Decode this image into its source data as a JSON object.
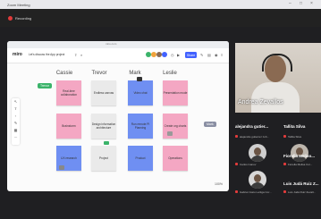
{
  "window": {
    "title": "Zoom Meeting",
    "recording_label": "Recording"
  },
  "browser": {
    "url": "miro.com"
  },
  "miro": {
    "logo": "miro",
    "board_name": "Let's discuss the App project",
    "share_label": "Share",
    "zoom_level": "100%",
    "columns": [
      "Cassie",
      "Trevor",
      "Mark",
      "Leslie"
    ],
    "stickies": [
      {
        "text": "Real-time collaboration",
        "color": "#f4a7c3"
      },
      {
        "text": "Endless canvas",
        "color": "#eaeaea"
      },
      {
        "text": "Video chat",
        "color": "#6f8ff2"
      },
      {
        "text": "Presentation mode",
        "color": "#f4a7c3"
      },
      {
        "text": "Brainstorm",
        "color": "#f4a7c3"
      },
      {
        "text": "Design information architecture",
        "color": "#eaeaea"
      },
      {
        "text": "Run remote PI Planning",
        "color": "#6f8ff2"
      },
      {
        "text": "Create org charts",
        "color": "#f4a7c3"
      },
      {
        "text": "UX research",
        "color": "#6f8ff2"
      },
      {
        "text": "Project",
        "color": "#eaeaea"
      },
      {
        "text": "Product",
        "color": "#6f8ff2"
      },
      {
        "text": "Operations",
        "color": "#f4a7c3"
      }
    ],
    "cursors": [
      {
        "name": "Trevor",
        "color": "#3bb36a"
      },
      {
        "name": "Mark",
        "color": "#8a8fa3"
      }
    ]
  },
  "participants": {
    "main": {
      "name": "Andrea Zevallos"
    },
    "tiles": [
      {
        "name": "alejandra gutier...",
        "sub": "alejandra gutierrez zuh..."
      },
      {
        "name": "Tallita Silva",
        "sub": "Tallita Silva"
      },
      {
        "name": "Fiorella Meliso...",
        "sub": "Carlos Ivanov"
      },
      {
        "name": "Luis Judá Ruiz Z...",
        "sub": "Fiorella Melisa Cur..."
      },
      {
        "name": "",
        "sub": "Gabriel Justo Lartiga Cor..."
      },
      {
        "name": "",
        "sub": "Luis Judá Ruiz Zevall..."
      }
    ]
  },
  "icons": [
    "close-icon",
    "minimize-icon",
    "maximize-icon",
    "record-icon",
    "mic-muted-icon"
  ]
}
